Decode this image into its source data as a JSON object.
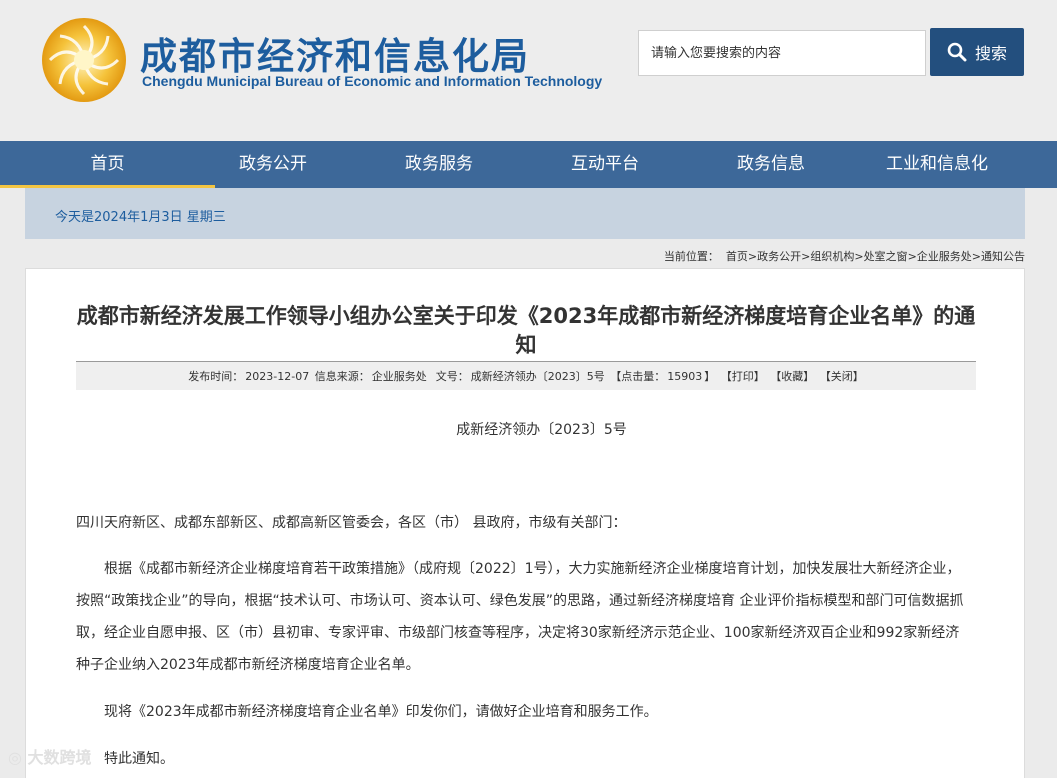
{
  "header": {
    "title_cn": "成都市经济和信息化局",
    "title_en": "Chengdu Municipal Bureau of Economic and Information Technology",
    "search_placeholder": "请输入您要搜索的内容",
    "search_button_label": "搜索",
    "brand_color": "#1d5d9e"
  },
  "nav": {
    "items": [
      {
        "label": "首页",
        "active": true
      },
      {
        "label": "政务公开"
      },
      {
        "label": "政务服务"
      },
      {
        "label": "互动平台"
      },
      {
        "label": "政务信息"
      },
      {
        "label": "工业和信息化"
      }
    ],
    "background": "#3d6899",
    "active_underline": "#f3c542"
  },
  "date_bar": {
    "text": "今天是2024年1月3日 星期三"
  },
  "breadcrumb": {
    "label": "当前位置：",
    "items": [
      "首页",
      "政务公开",
      "组织机构",
      "处室之窗",
      "企业服务处",
      "通知公告"
    ],
    "separator": ">"
  },
  "article": {
    "title": "成都市新经济发展工作领导小组办公室关于印发《2023年成都市新经济梯度培育企业名单》的通知",
    "meta": {
      "publish_label": "发布时间：",
      "publish_date": "2023-12-07",
      "source_label": "信息来源：",
      "source": "企业服务处",
      "docno_label": "文号：",
      "docno": "成新经济领办〔2023〕5号",
      "hits_label": "【点击量：",
      "hits": "15903",
      "hits_close": "】",
      "print": "【打印】",
      "favorite": "【收藏】",
      "close": "【关闭】"
    },
    "doc_number": "成新经济领办〔2023〕5号",
    "address": "四川天府新区、成都东部新区、成都高新区管委会，各区（市） 县政府，市级有关部门：",
    "main_paragraph": "根据《成都市新经济企业梯度培育若干政策措施》（成府规〔2022〕1号），大力实施新经济企业梯度培育计划，加快发展壮大新经济企业，按照“政策找企业”的导向，根据“技术认可、市场认可、资本认可、绿色发展”的思路，通过新经济梯度培育 企业评价指标模型和部门可信数据抓取，经企业自愿申报、区（市）县初审、专家评审、市级部门核查等程序，决定将30家新经济示范企业、100家新经济双百企业和992家新经济种子企业纳入2023年成都市新经济梯度培育企业名单。",
    "issue_paragraph": "现将《2023年成都市新经济梯度培育企业名单》印发你们，请做好企业培育和服务工作。",
    "notice_paragraph": "特此通知。"
  },
  "watermark": {
    "text": "大数跨境"
  }
}
